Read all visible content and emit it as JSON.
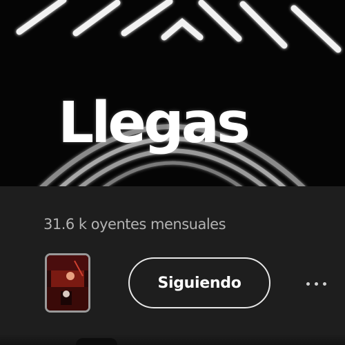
{
  "artist": {
    "name": "Llegas",
    "monthly_listeners": "31.6 k oyentes mensuales"
  },
  "actions": {
    "follow_label": "Siguiendo",
    "more_icon": "more-horizontal-icon"
  },
  "colors": {
    "hero_background": "#050505",
    "panel_background": "#1e1e1e",
    "primary_text": "#ffffff",
    "secondary_text": "#b3b3b3",
    "button_border": "#e8e8e8"
  }
}
